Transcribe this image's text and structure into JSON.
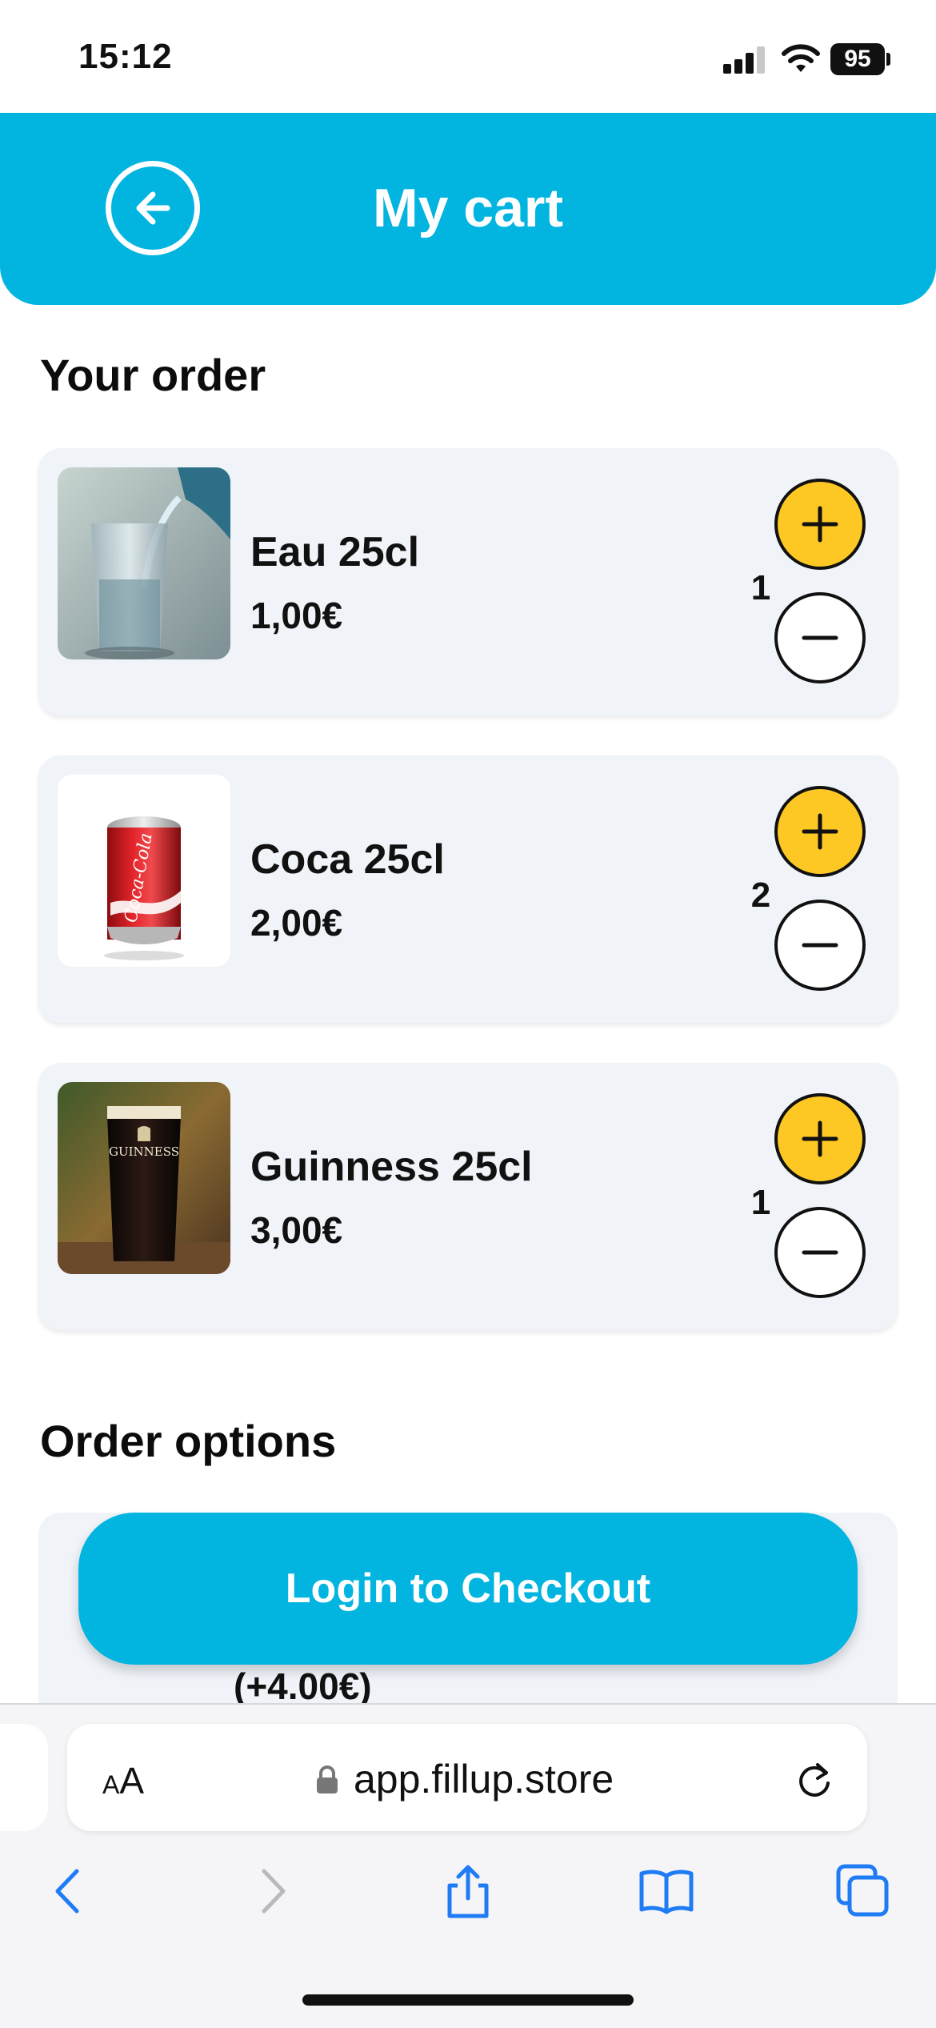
{
  "status_bar": {
    "time": "15:12",
    "battery": "95"
  },
  "header": {
    "title": "My cart",
    "back_icon": "arrow-left-circle-icon"
  },
  "order_section": {
    "title": "Your order"
  },
  "items": [
    {
      "name": "Eau 25cl",
      "price": "1,00€",
      "qty": "1",
      "image": "water-glass"
    },
    {
      "name": "Coca 25cl",
      "price": "2,00€",
      "qty": "2",
      "image": "coca-cola-can"
    },
    {
      "name": "Guinness 25cl",
      "price": "3,00€",
      "qty": "1",
      "image": "guinness-pint"
    }
  ],
  "options_section": {
    "title": "Order options",
    "visible_price": "(+4.00€)"
  },
  "checkout": {
    "label": "Login to Checkout"
  },
  "browser": {
    "text_size_label_small": "A",
    "text_size_label_large": "A",
    "url": "app.fillup.store"
  },
  "colors": {
    "accent": "#02b4e0",
    "plus_button": "#fdc824",
    "card_bg": "#f0f4f9"
  }
}
